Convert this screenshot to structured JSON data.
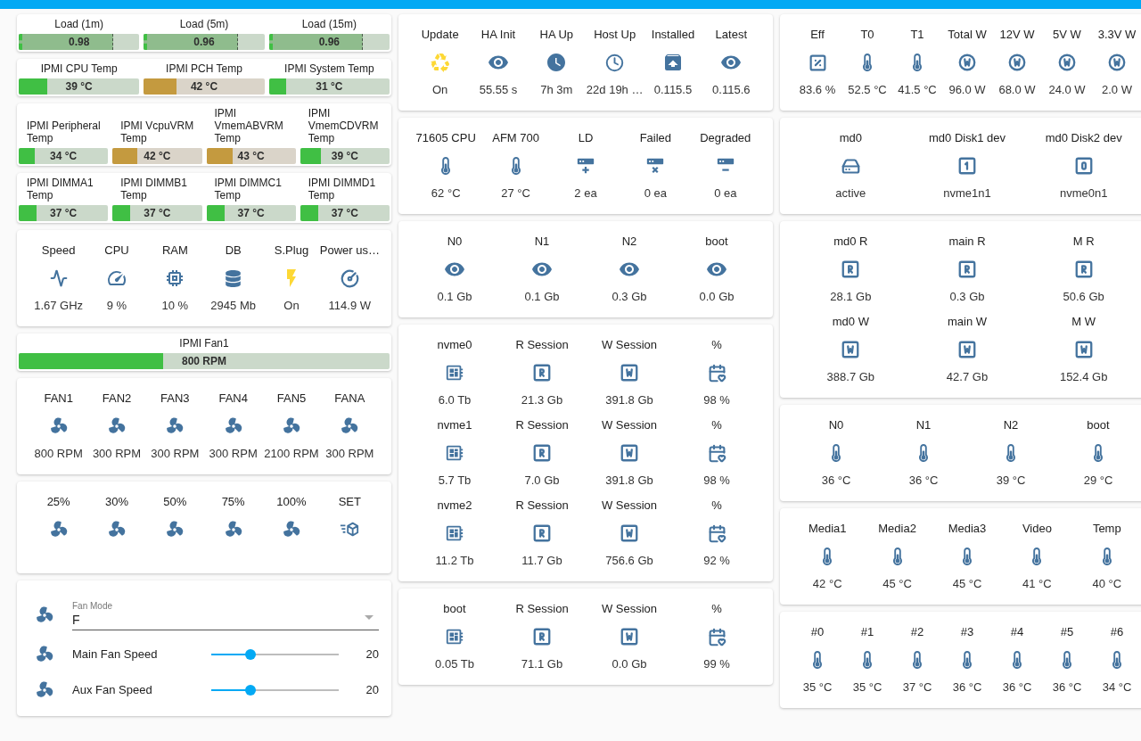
{
  "columns": [
    {
      "cards": [
        {
          "kind": "load_bars",
          "items": [
            {
              "name": "Load (1m)",
              "value": "0.98",
              "level": 0.78
            },
            {
              "name": "Load (5m)",
              "value": "0.96",
              "level": 0.78
            },
            {
              "name": "Load (15m)",
              "value": "0.96",
              "level": 0.78
            }
          ]
        },
        {
          "kind": "temp_bars",
          "items": [
            {
              "name": "IPMI CPU Temp",
              "value": "39 °C",
              "level": 0.24,
              "color": "#40bf44"
            },
            {
              "name": "IPMI PCH Temp",
              "value": "42 °C",
              "level": 0.27,
              "color": "#c49a3f"
            },
            {
              "name": "IPMI System Temp",
              "value": "31 °C",
              "level": 0.14,
              "color": "#40bf44"
            }
          ]
        },
        {
          "kind": "temp_bars",
          "items": [
            {
              "name": "IPMI Peripheral Temp",
              "value": "34 °C",
              "level": 0.18,
              "color": "#40bf44"
            },
            {
              "name": "IPMI VcpuVRM Temp",
              "value": "42 °C",
              "level": 0.28,
              "color": "#c49a3f"
            },
            {
              "name": "IPMI VmemABVRM Temp",
              "value": "43 °C",
              "level": 0.29,
              "color": "#c49a3f"
            },
            {
              "name": "IPMI VmemCDVRM Temp",
              "value": "39 °C",
              "level": 0.23,
              "color": "#40bf44"
            }
          ]
        },
        {
          "kind": "temp_bars",
          "items": [
            {
              "name": "IPMI DIMMA1 Temp",
              "value": "37 °C",
              "level": 0.2,
              "color": "#40bf44"
            },
            {
              "name": "IPMI DIMMB1 Temp",
              "value": "37 °C",
              "level": 0.2,
              "color": "#40bf44"
            },
            {
              "name": "IPMI DIMMC1 Temp",
              "value": "37 °C",
              "level": 0.2,
              "color": "#40bf44"
            },
            {
              "name": "IPMI DIMMD1 Temp",
              "value": "37 °C",
              "level": 0.2,
              "color": "#40bf44"
            }
          ]
        },
        {
          "kind": "stats",
          "rows": [
            [
              {
                "name": "Speed",
                "value": "1.67 GHz",
                "active": false
              },
              {
                "name": "CPU",
                "value": "9 %",
                "active": false
              },
              {
                "name": "RAM",
                "value": "10 %",
                "active": false
              },
              {
                "name": "DB",
                "value": "2945 Mb",
                "active": false
              },
              {
                "name": "S.Plug",
                "value": "On",
                "active": true
              },
              {
                "name": "Power us…",
                "value": "114.9 W",
                "active": false
              }
            ]
          ]
        },
        {
          "kind": "temp_bars",
          "items": [
            {
              "name": "IPMI Fan1",
              "value": "800 RPM",
              "level": 0.39,
              "color": "#40bf44"
            }
          ]
        },
        {
          "kind": "stats",
          "rows": [
            [
              {
                "name": "FAN1",
                "value": "800 RPM"
              },
              {
                "name": "FAN2",
                "value": "300 RPM"
              },
              {
                "name": "FAN3",
                "value": "300 RPM"
              },
              {
                "name": "FAN4",
                "value": "300 RPM"
              },
              {
                "name": "FAN5",
                "value": "2100 RPM"
              },
              {
                "name": "FANA",
                "value": "300 RPM"
              }
            ]
          ]
        },
        {
          "kind": "stats",
          "rows": [
            [
              {
                "name": "25%"
              },
              {
                "name": "30%"
              },
              {
                "name": "50%"
              },
              {
                "name": "75%"
              },
              {
                "name": "100%"
              },
              {
                "name": "SET"
              }
            ]
          ]
        },
        {
          "kind": "fan_controls",
          "select": {
            "label": "Fan Mode",
            "value": "F"
          },
          "sliders": [
            {
              "name": "Main Fan Speed",
              "value": "20",
              "level": 0.31
            },
            {
              "name": "Aux Fan Speed",
              "value": "20",
              "level": 0.31
            }
          ]
        }
      ]
    },
    {
      "cards": [
        {
          "kind": "stats",
          "rows": [
            [
              {
                "name": "Update",
                "value": "On",
                "active": true
              },
              {
                "name": "HA Init",
                "value": "55.55 s",
                "active": false
              },
              {
                "name": "HA Up",
                "value": "7h 3m",
                "active": false
              },
              {
                "name": "Host Up",
                "value": "22d 19h …",
                "active": false
              },
              {
                "name": "Installed",
                "value": "0.115.5",
                "active": false
              },
              {
                "name": "Latest",
                "value": "0.115.6",
                "active": false
              }
            ]
          ]
        },
        {
          "kind": "stats",
          "rows": [
            [
              {
                "name": "71605 CPU",
                "value": "62 °C"
              },
              {
                "name": "AFM 700",
                "value": "27 °C"
              },
              {
                "name": "LD",
                "value": "2 ea"
              },
              {
                "name": "Failed",
                "value": "0 ea"
              },
              {
                "name": "Degraded",
                "value": "0 ea"
              }
            ]
          ]
        },
        {
          "kind": "stats",
          "rows": [
            [
              {
                "name": "N0",
                "value": "0.1 Gb"
              },
              {
                "name": "N1",
                "value": "0.1 Gb"
              },
              {
                "name": "N2",
                "value": "0.3 Gb"
              },
              {
                "name": "boot",
                "value": "0.0 Gb"
              }
            ]
          ]
        },
        {
          "kind": "stats",
          "rows": [
            [
              {
                "name": "nvme0",
                "value": "6.0 Tb"
              },
              {
                "name": "R Session",
                "value": "21.3 Gb"
              },
              {
                "name": "W Session",
                "value": "391.8 Gb"
              },
              {
                "name": "%",
                "value": "98 %"
              }
            ],
            [
              {
                "name": "nvme1",
                "value": "5.7 Tb"
              },
              {
                "name": "R Session",
                "value": "7.0 Gb"
              },
              {
                "name": "W Session",
                "value": "391.8 Gb"
              },
              {
                "name": "%",
                "value": "98 %"
              }
            ],
            [
              {
                "name": "nvme2",
                "value": "11.2 Tb"
              },
              {
                "name": "R Session",
                "value": "11.7 Gb"
              },
              {
                "name": "W Session",
                "value": "756.6 Gb"
              },
              {
                "name": "%",
                "value": "92 %"
              }
            ]
          ]
        },
        {
          "kind": "stats",
          "rows": [
            [
              {
                "name": "boot",
                "value": "0.05 Tb"
              },
              {
                "name": "R Session",
                "value": "71.1 Gb"
              },
              {
                "name": "W Session",
                "value": "0.0 Gb"
              },
              {
                "name": "%",
                "value": "99 %"
              }
            ]
          ]
        }
      ]
    },
    {
      "cards": [
        {
          "kind": "stats",
          "rows": [
            [
              {
                "name": "Eff",
                "value": "83.6 %"
              },
              {
                "name": "T0",
                "value": "52.5 °C"
              },
              {
                "name": "T1",
                "value": "41.5 °C"
              },
              {
                "name": "Total W",
                "value": "96.0 W"
              },
              {
                "name": "12V W",
                "value": "68.0 W"
              },
              {
                "name": "5V W",
                "value": "24.0 W"
              },
              {
                "name": "3.3V W",
                "value": "2.0 W"
              }
            ]
          ]
        },
        {
          "kind": "stats",
          "rows": [
            [
              {
                "name": "md0",
                "value": "active"
              },
              {
                "name": "md0 Disk1 dev",
                "value": "nvme1n1"
              },
              {
                "name": "md0 Disk2 dev",
                "value": "nvme0n1"
              }
            ]
          ]
        },
        {
          "kind": "stats",
          "rows": [
            [
              {
                "name": "md0 R",
                "value": "28.1 Gb"
              },
              {
                "name": "main R",
                "value": "0.3 Gb"
              },
              {
                "name": "M R",
                "value": "50.6 Gb"
              }
            ],
            [
              {
                "name": "md0 W",
                "value": "388.7 Gb"
              },
              {
                "name": "main W",
                "value": "42.7 Gb"
              },
              {
                "name": "M W",
                "value": "152.4 Gb"
              }
            ]
          ]
        },
        {
          "kind": "stats",
          "rows": [
            [
              {
                "name": "N0",
                "value": "36 °C"
              },
              {
                "name": "N1",
                "value": "36 °C"
              },
              {
                "name": "N2",
                "value": "39 °C"
              },
              {
                "name": "boot",
                "value": "29 °C"
              }
            ]
          ]
        },
        {
          "kind": "stats",
          "rows": [
            [
              {
                "name": "Media1",
                "value": "42 °C"
              },
              {
                "name": "Media2",
                "value": "45 °C"
              },
              {
                "name": "Media3",
                "value": "45 °C"
              },
              {
                "name": "Video",
                "value": "41 °C"
              },
              {
                "name": "Temp",
                "value": "40 °C"
              }
            ]
          ]
        },
        {
          "kind": "stats",
          "rows": [
            [
              {
                "name": "#0",
                "value": "35 °C"
              },
              {
                "name": "#1",
                "value": "35 °C"
              },
              {
                "name": "#2",
                "value": "37 °C"
              },
              {
                "name": "#3",
                "value": "36 °C"
              },
              {
                "name": "#4",
                "value": "36 °C"
              },
              {
                "name": "#5",
                "value": "36 °C"
              },
              {
                "name": "#6",
                "value": "34 °C"
              }
            ]
          ]
        }
      ]
    }
  ]
}
